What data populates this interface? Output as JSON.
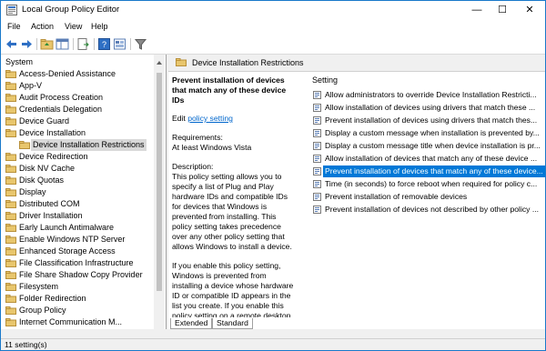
{
  "window": {
    "title": "Local Group Policy Editor",
    "minimize": "—",
    "maximize": "☐",
    "close": "✕"
  },
  "menu": [
    "File",
    "Action",
    "View",
    "Help"
  ],
  "tree": {
    "items": [
      {
        "label": "System"
      },
      {
        "label": "Access-Denied Assistance"
      },
      {
        "label": "App-V"
      },
      {
        "label": "Audit Process Creation"
      },
      {
        "label": "Credentials Delegation"
      },
      {
        "label": "Device Guard"
      },
      {
        "label": "Device Installation"
      },
      {
        "label": "Device Installation Restrictions"
      },
      {
        "label": "Device Redirection"
      },
      {
        "label": "Disk NV Cache"
      },
      {
        "label": "Disk Quotas"
      },
      {
        "label": "Display"
      },
      {
        "label": "Distributed COM"
      },
      {
        "label": "Driver Installation"
      },
      {
        "label": "Early Launch Antimalware"
      },
      {
        "label": "Enable Windows NTP Server"
      },
      {
        "label": "Enhanced Storage Access"
      },
      {
        "label": "File Classification Infrastructure"
      },
      {
        "label": "File Share Shadow Copy Provider"
      },
      {
        "label": "Filesystem"
      },
      {
        "label": "Folder Redirection"
      },
      {
        "label": "Group Policy"
      },
      {
        "label": "Internet Communication M..."
      }
    ]
  },
  "right": {
    "header": "Device Installation Restrictions",
    "desc": {
      "title": "Prevent installation of devices that match any of these device IDs",
      "edit_prefix": "Edit",
      "edit_link": "policy setting",
      "req_label": "Requirements:",
      "req_value": "At least Windows Vista",
      "desc_label": "Description:",
      "p1": "This policy setting allows you to specify a list of Plug and Play hardware IDs and compatible IDs for devices that Windows is prevented from installing. This policy setting takes precedence over any other policy setting that allows Windows to install a device.",
      "p2": "If you enable this policy setting, Windows is prevented from installing a device whose hardware ID or compatible ID appears in the list you create. If you enable this policy setting on a remote desktop server, the policy"
    },
    "list": {
      "column": "Setting",
      "items": [
        "Allow administrators to override Device Installation Restricti...",
        "Allow installation of devices using drivers that match these ...",
        "Prevent installation of devices using drivers that match thes...",
        "Display a custom message when installation is prevented by...",
        "Display a custom message title when device installation is pr...",
        "Allow installation of devices that match any of these device ...",
        "Prevent installation of devices that match any of these device...",
        "Time (in seconds) to force reboot when required for policy c...",
        "Prevent installation of removable devices",
        "Prevent installation of devices not described by other policy ..."
      ],
      "selected_index": 6
    },
    "tabs": [
      "Extended",
      "Standard"
    ]
  },
  "status": "11 setting(s)",
  "colors": {
    "selection": "#0078d7",
    "link": "#0066cc",
    "folder": "#e8c66d"
  }
}
